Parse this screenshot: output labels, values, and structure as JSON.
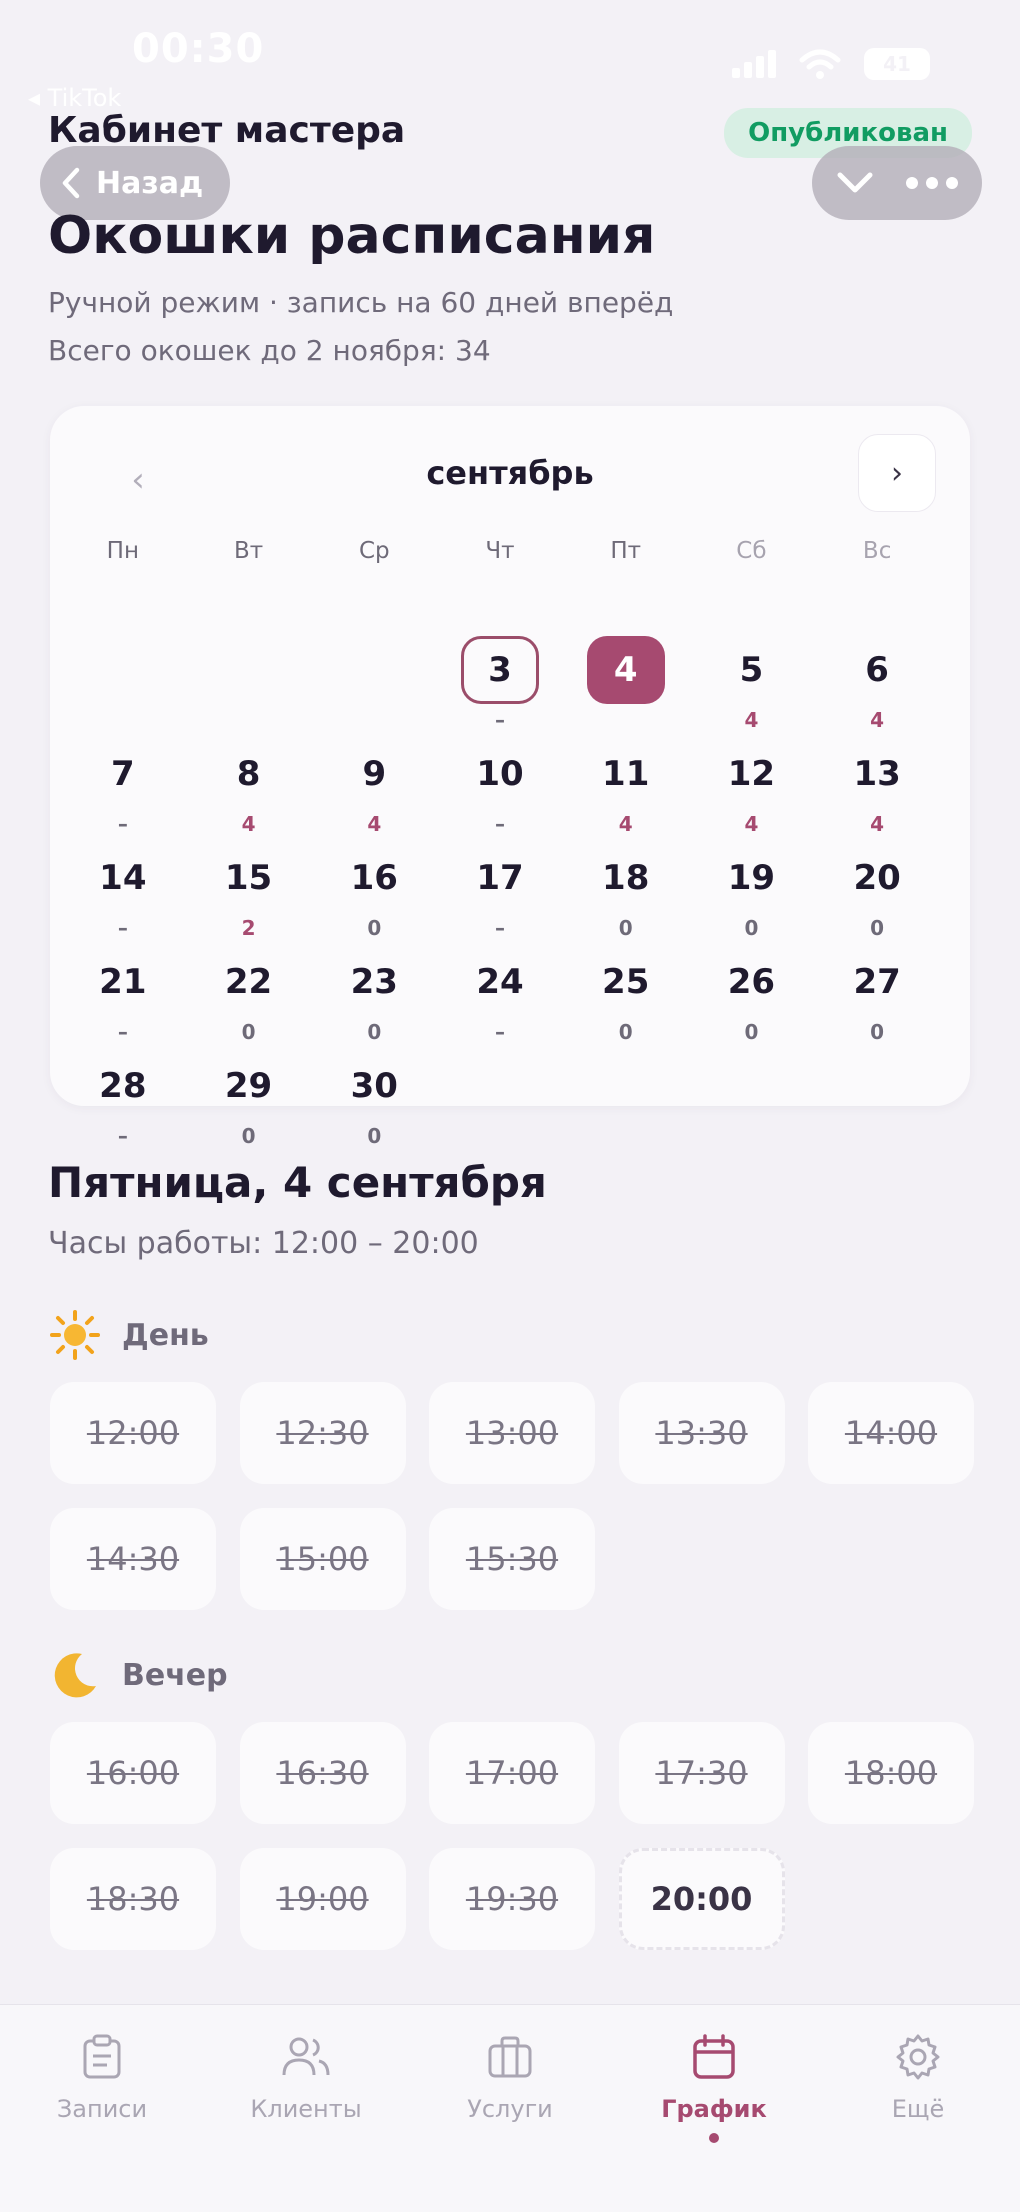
{
  "status_bar": {
    "time": "00:30",
    "battery": "41",
    "back_app": "◂ TikTok"
  },
  "header": {
    "title": "Кабинет мастера",
    "badge": "Опубликован",
    "back_label": "Назад"
  },
  "page": {
    "title": "Окошки расписания",
    "subtitle": "Ручной режим · запись на 60 дней вперёд",
    "total": "Всего окошек до 2 ноября: 34"
  },
  "calendar": {
    "month": "сентябрь",
    "prev": "‹",
    "next": "›",
    "weekdays": [
      "Пн",
      "Вт",
      "Ср",
      "Чт",
      "Пт",
      "Сб",
      "Вс"
    ],
    "days": [
      {
        "d": "3",
        "s": "–"
      },
      {
        "d": "4",
        "s": ""
      },
      {
        "d": "5",
        "s": "4"
      },
      {
        "d": "6",
        "s": "4"
      },
      {
        "d": "7",
        "s": "–"
      },
      {
        "d": "8",
        "s": "4"
      },
      {
        "d": "9",
        "s": "4"
      },
      {
        "d": "10",
        "s": "–"
      },
      {
        "d": "11",
        "s": "4"
      },
      {
        "d": "12",
        "s": "4"
      },
      {
        "d": "13",
        "s": "4"
      },
      {
        "d": "14",
        "s": "–"
      },
      {
        "d": "15",
        "s": "2"
      },
      {
        "d": "16",
        "s": "0"
      },
      {
        "d": "17",
        "s": "–"
      },
      {
        "d": "18",
        "s": "0"
      },
      {
        "d": "19",
        "s": "0"
      },
      {
        "d": "20",
        "s": "0"
      },
      {
        "d": "21",
        "s": "–"
      },
      {
        "d": "22",
        "s": "0"
      },
      {
        "d": "23",
        "s": "0"
      },
      {
        "d": "24",
        "s": "–"
      },
      {
        "d": "25",
        "s": "0"
      },
      {
        "d": "26",
        "s": "0"
      },
      {
        "d": "27",
        "s": "0"
      },
      {
        "d": "28",
        "s": "–"
      },
      {
        "d": "29",
        "s": "0"
      },
      {
        "d": "30",
        "s": "0"
      }
    ]
  },
  "selected_day": {
    "title": "Пятница, 4 сентября",
    "hours": "Часы работы: 12:00 – 20:00"
  },
  "day_section": {
    "label": "День",
    "slots": [
      "12:00",
      "12:30",
      "13:00",
      "13:30",
      "14:00",
      "14:30",
      "15:00",
      "15:30"
    ]
  },
  "evening_section": {
    "label": "Вечер",
    "slots": [
      "16:00",
      "16:30",
      "17:00",
      "17:30",
      "18:00",
      "18:30",
      "19:00",
      "19:30"
    ],
    "free_slot": "20:00"
  },
  "tabs": [
    {
      "label": "Записи"
    },
    {
      "label": "Клиенты"
    },
    {
      "label": "Услуги"
    },
    {
      "label": "График"
    },
    {
      "label": "Ещё"
    }
  ],
  "colors": {
    "accent": "#a64a70",
    "published": "#119c62",
    "background": "#f3f1f6"
  }
}
